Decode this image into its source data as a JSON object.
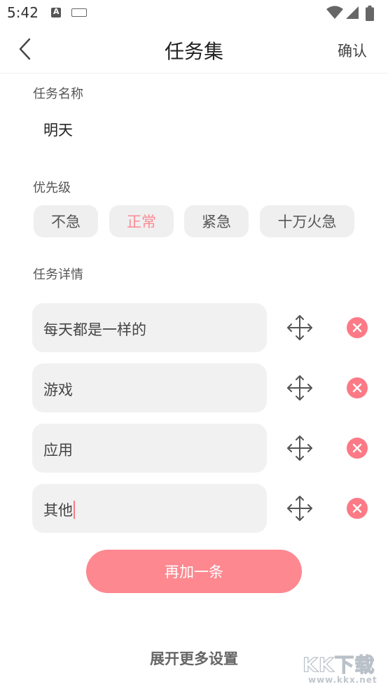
{
  "status_bar": {
    "time": "5:42"
  },
  "header": {
    "title": "任务集",
    "confirm_label": "确认"
  },
  "task_name": {
    "label": "任务名称",
    "value": "明天"
  },
  "priority": {
    "label": "优先级",
    "options": [
      "不急",
      "正常",
      "紧急",
      "十万火急"
    ],
    "selected": "正常",
    "selected_color": "#fb8a94"
  },
  "details": {
    "label": "任务详情",
    "items": [
      "每天都是一样的",
      "游戏",
      "应用",
      "其他"
    ]
  },
  "add_button_label": "再加一条",
  "expand_label": "展开更多设置",
  "colors": {
    "accent": "#fd8890",
    "remove": "#fb7a86"
  },
  "watermark": {
    "main": "KK下载",
    "sub": "www.kkx.net"
  }
}
